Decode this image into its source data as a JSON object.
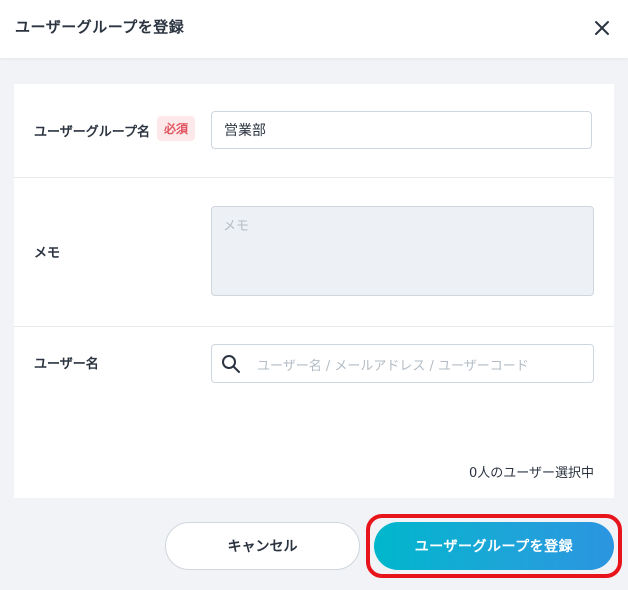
{
  "dialog": {
    "title": "ユーザーグループを登録",
    "close_icon": "close-icon"
  },
  "form": {
    "group_name": {
      "label": "ユーザーグループ名",
      "required_badge": "必須",
      "value": "営業部"
    },
    "memo": {
      "label": "メモ",
      "placeholder": "メモ"
    },
    "users": {
      "label": "ユーザー名",
      "search_icon": "search-icon",
      "placeholder": "ユーザー名 / メールアドレス / ユーザーコード",
      "selected_count_text": "0人のユーザー選択中"
    }
  },
  "footer": {
    "cancel_label": "キャンセル",
    "submit_label": "ユーザーグループを登録"
  },
  "colors": {
    "accent_start": "#00b7cc",
    "accent_end": "#2b95e0",
    "required": "#e05561",
    "highlight": "#e8141b"
  }
}
